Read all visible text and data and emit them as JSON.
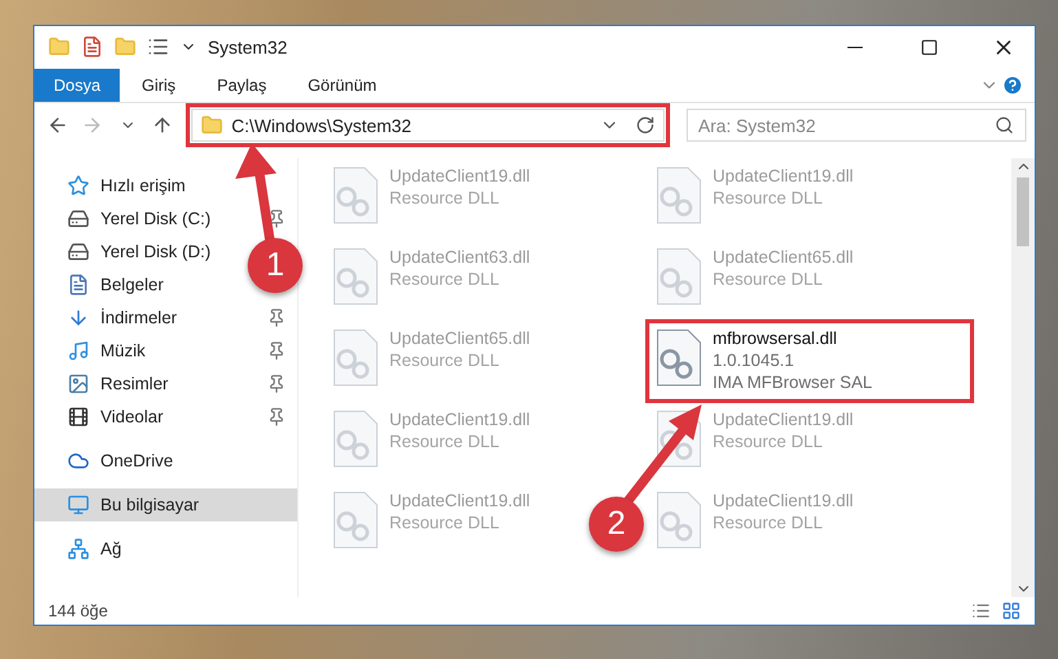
{
  "window": {
    "title": "System32"
  },
  "ribbon_tabs": [
    {
      "label": "Dosya",
      "selected": true
    },
    {
      "label": "Giriş",
      "selected": false
    },
    {
      "label": "Paylaş",
      "selected": false
    },
    {
      "label": "Görünüm",
      "selected": false
    }
  ],
  "address": {
    "path": "C:\\Windows\\System32",
    "highlighted": true
  },
  "search": {
    "placeholder": "Ara: System32"
  },
  "sidebar": {
    "items": [
      {
        "label": "Hızlı erişim",
        "kind": "star",
        "selected": false,
        "children": [
          {
            "label": "Yerel Disk (C:)",
            "kind": "drive",
            "selected": false,
            "pinned": true
          },
          {
            "label": "Yerel Disk (D:)",
            "kind": "drive",
            "selected": false,
            "pinned": false
          },
          {
            "label": "Belgeler",
            "kind": "documents",
            "selected": false,
            "pinned": false
          },
          {
            "label": "İndirmeler",
            "kind": "download",
            "selected": false,
            "pinned": true
          },
          {
            "label": "Müzik",
            "kind": "music",
            "selected": false,
            "pinned": true
          },
          {
            "label": "Resimler",
            "kind": "pictures",
            "selected": false,
            "pinned": true
          },
          {
            "label": "Videolar",
            "kind": "videos",
            "selected": false,
            "pinned": true
          }
        ]
      },
      {
        "label": "OneDrive",
        "kind": "cloud",
        "selected": false,
        "pinned": false
      },
      {
        "label": "Bu bilgisayar",
        "kind": "computer",
        "selected": true,
        "pinned": false
      },
      {
        "label": "Ağ",
        "kind": "network",
        "selected": false,
        "pinned": false
      }
    ]
  },
  "files": [
    {
      "name": "UpdateClient19.dll",
      "lines": [
        "Resource DLL"
      ],
      "selected": false
    },
    {
      "name": "UpdateClient19.dll",
      "lines": [
        "Resource DLL"
      ],
      "selected": false
    },
    {
      "name": "UpdateClient63.dll",
      "lines": [
        "Resource DLL"
      ],
      "selected": false
    },
    {
      "name": "UpdateClient65.dll",
      "lines": [
        "Resource DLL"
      ],
      "selected": false
    },
    {
      "name": "UpdateClient65.dll",
      "lines": [
        "Resource DLL"
      ],
      "selected": false
    },
    {
      "name": "mfbrowsersal.dll",
      "lines": [
        "1.0.1045.1",
        "IMA MFBrowser SAL"
      ],
      "selected": true
    },
    {
      "name": "UpdateClient19.dll",
      "lines": [
        "Resource DLL"
      ],
      "selected": false
    },
    {
      "name": "UpdateClient19.dll",
      "lines": [
        "Resource DLL"
      ],
      "selected": false
    },
    {
      "name": "UpdateClient19.dll",
      "lines": [
        "Resource DLL"
      ],
      "selected": false
    },
    {
      "name": "UpdateClient19.dll",
      "lines": [
        "Resource DLL"
      ],
      "selected": false
    }
  ],
  "status_bar": {
    "count": "144 öğe"
  },
  "annotations": [
    {
      "label": "1"
    },
    {
      "label": "2"
    }
  ]
}
